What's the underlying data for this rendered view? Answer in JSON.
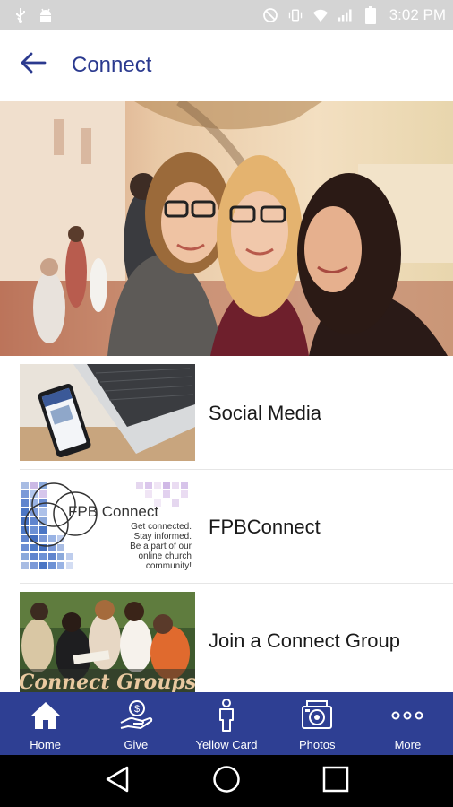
{
  "status_bar": {
    "time": "3:02 PM",
    "icons": [
      "usb-icon",
      "android-debug-icon",
      "no-sim-icon",
      "vibrate-icon",
      "wifi-icon",
      "signal-icon",
      "battery-icon"
    ]
  },
  "header": {
    "title": "Connect",
    "back_icon": "arrow-left-icon"
  },
  "colors": {
    "accent": "#2e3f93",
    "title": "#2b3a8f",
    "status_bar": "#d4d4d4",
    "system_nav": "#000000"
  },
  "list": {
    "items": [
      {
        "label": "Social Media"
      },
      {
        "label": "FPBConnect"
      },
      {
        "label": "Join a Connect Group"
      }
    ]
  },
  "thumbs": {
    "fpb_title": "FPB Connect",
    "fpb_line1": "Get connected.",
    "fpb_line2": "Stay informed.",
    "fpb_line3": "Be a part of our",
    "fpb_line4": "online church",
    "fpb_line5": "community!",
    "groups_text": "Connect Groups"
  },
  "bottom_nav": {
    "items": [
      {
        "label": "Home",
        "icon": "home-icon"
      },
      {
        "label": "Give",
        "icon": "give-icon"
      },
      {
        "label": "Yellow Card",
        "icon": "person-icon"
      },
      {
        "label": "Photos",
        "icon": "camera-icon"
      },
      {
        "label": "More",
        "icon": "more-icon"
      }
    ]
  },
  "system_nav": {
    "icons": [
      "back-triangle-icon",
      "home-circle-icon",
      "recents-square-icon"
    ]
  }
}
